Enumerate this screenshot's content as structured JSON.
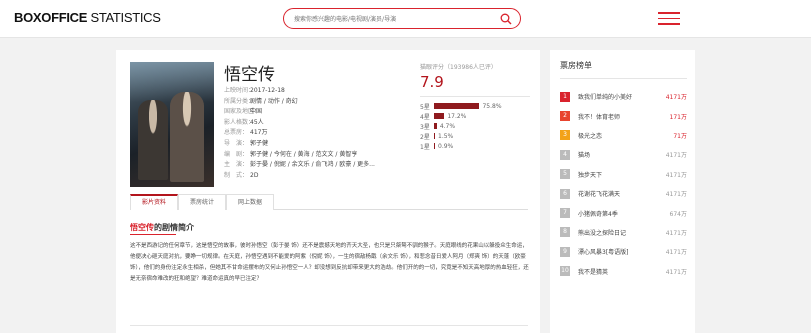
{
  "header": {
    "logo_bold": "BOXOFFICE",
    "logo_light": " STATISTICS",
    "search_placeholder": "搜索你感兴趣的电影/电视剧/演员/导演"
  },
  "movie": {
    "title": "悟空传",
    "info": [
      {
        "k": "上映时间：",
        "v": "2017-12-18"
      },
      {
        "k": "所属分类：",
        "v": "剧情 / 动作 / 奇幻"
      },
      {
        "k": "国家及地区：",
        "v": "中国"
      },
      {
        "k": "影人格数：",
        "v": "45人"
      },
      {
        "k": "总票房：",
        "v": "417万"
      },
      {
        "k": "导　演：",
        "v": "郭子健"
      },
      {
        "k": "编　剧：",
        "v": "郭子健 / 今何在 / 黄海 / 范文文 / 黄智亨"
      },
      {
        "k": "主　演：",
        "v": "彭于晏 / 倪妮 / 余文乐 / 俞飞鸿 / 欧豪 / 更多..."
      },
      {
        "k": "制　式：",
        "v": "2D"
      }
    ]
  },
  "rating": {
    "label": "猫眼评分（193986人已评）",
    "score": "7.9",
    "bars": [
      {
        "star": "5星",
        "pct": 75.8,
        "pct_label": "75.8%"
      },
      {
        "star": "4星",
        "pct": 17.2,
        "pct_label": "17.2%"
      },
      {
        "star": "3星",
        "pct": 4.7,
        "pct_label": "4.7%"
      },
      {
        "star": "2星",
        "pct": 1.5,
        "pct_label": "1.5%"
      },
      {
        "star": "1星",
        "pct": 0.9,
        "pct_label": "0.9%"
      }
    ],
    "bar_color": "#8f1a1e"
  },
  "tabs": [
    "影片资料",
    "票房统计",
    "网上数据"
  ],
  "section": {
    "title_a": "悟空传",
    "title_b": "的剧情简介",
    "plot": "这不是西游记的任何章节，这是悟空的故事，彼时孙悟空（彭于晏 饰）还不是震撼天地的齐天大圣，也只是只桀骜不驯的猴子。天庭眼线的花果山以躲投众生命运，他便决心砸天庭对抗，要睁一切规律。在天庭，孙悟空遇到不能爱的阿紫（倪妮 饰），一生的宿敌杨戬（余文乐 饰），和悲念昔日爱人阿月（郑爽 饰）的天蓬（欧豪 饰），他们的身份注定永生相杀，但她其不甘命运摆布的又何止孙悟空一人？却没想到反抗却带来更大的浩劫。他们开的的一切，究竟是不知天高地厚的热血轻狂，还是无奈宿命难改的狂和绝望？难道命运真的早已注定？"
  },
  "sidebar": {
    "title": "票房榜单",
    "items": [
      {
        "rank": "1",
        "title": "致我们单纯的小美好",
        "gross": "4171万",
        "color": "#d9232d"
      },
      {
        "rank": "2",
        "title": "我不！体育老师",
        "gross": "171万",
        "color": "#e8442e"
      },
      {
        "rank": "3",
        "title": "极光之恋",
        "gross": "71万",
        "color": "#f3a218"
      },
      {
        "rank": "4",
        "title": "猫场",
        "gross": "4171万",
        "color": "#bbbbbb"
      },
      {
        "rank": "5",
        "title": "独步天下",
        "gross": "4171万",
        "color": "#bbbbbb"
      },
      {
        "rank": "6",
        "title": "花谢花飞花满天",
        "gross": "4171万",
        "color": "#bbbbbb"
      },
      {
        "rank": "7",
        "title": "小猪佩奇第4季",
        "gross": "674万",
        "color": "#bbbbbb"
      },
      {
        "rank": "8",
        "title": "熊出没之探险日记",
        "gross": "4171万",
        "color": "#bbbbbb"
      },
      {
        "rank": "9",
        "title": "漂心风暴3[粤语版]",
        "gross": "4171万",
        "color": "#bbbbbb"
      },
      {
        "rank": "10",
        "title": "我不是猜英",
        "gross": "4171万",
        "color": "#bbbbbb"
      }
    ]
  }
}
